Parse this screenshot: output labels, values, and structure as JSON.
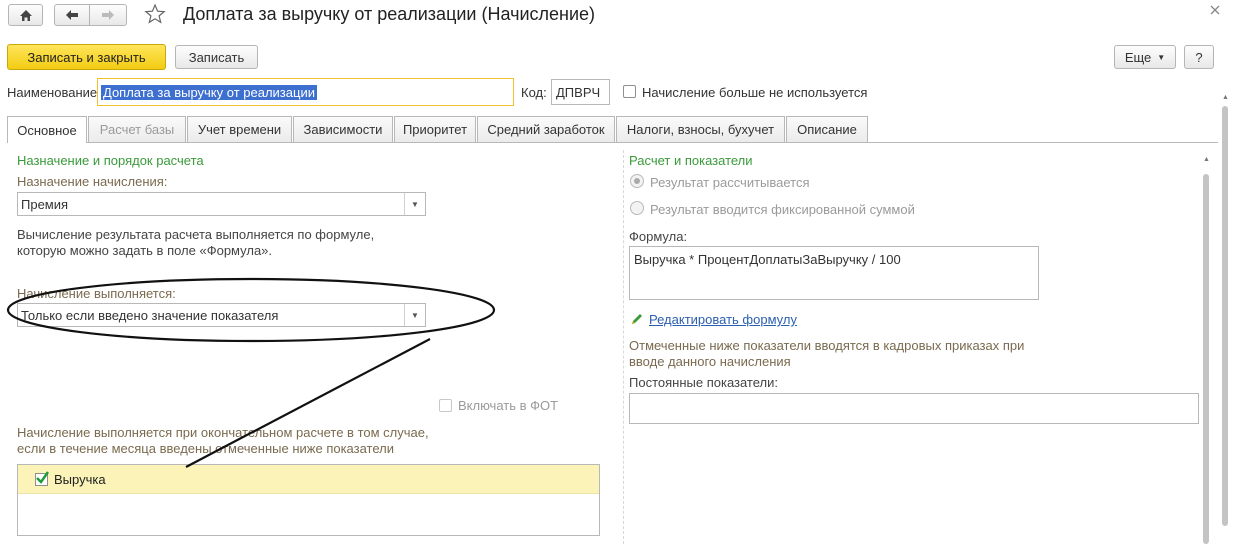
{
  "window": {
    "title": "Доплата за выручку от реализации (Начисление)",
    "home_icon": "home-icon",
    "back_icon": "arrow-left-icon",
    "forward_icon": "arrow-right-icon",
    "star_icon": "star-icon",
    "close_icon": "close-icon"
  },
  "toolbar": {
    "save_close_label": "Записать и закрыть",
    "save_label": "Записать",
    "more_label": "Еще",
    "help_label": "?"
  },
  "form": {
    "name_label": "Наименование:",
    "name_value": "Доплата за выручку от реализации",
    "code_label": "Код:",
    "code_value": "ДПВРЧ",
    "not_used_label": "Начисление больше не используется"
  },
  "tabs": [
    {
      "label": "Основное"
    },
    {
      "label": "Расчет базы"
    },
    {
      "label": "Учет времени"
    },
    {
      "label": "Зависимости"
    },
    {
      "label": "Приоритет"
    },
    {
      "label": "Средний заработок"
    },
    {
      "label": "Налоги, взносы, бухучет"
    },
    {
      "label": "Описание"
    }
  ],
  "left": {
    "section_title": "Назначение и порядок расчета",
    "purpose_label": "Назначение начисления:",
    "purpose_value": "Премия",
    "calc_note_1": "Вычисление результата расчета выполняется по формуле,",
    "calc_note_2": "которую можно задать в поле «Формула».",
    "performed_label": "Начисление выполняется:",
    "performed_value": "Только если введено значение показателя",
    "fot_label": "Включать в ФОТ",
    "info_1": "Начисление выполняется при окончательном расчете в том случае,",
    "info_2": "если в течение месяца введены отмеченные ниже показатели",
    "indicators": [
      {
        "label": "Выручка",
        "checked": true
      }
    ]
  },
  "right": {
    "section_title": "Расчет и показатели",
    "radio_calculated": "Результат рассчитывается",
    "radio_fixed": "Результат вводится фиксированной суммой",
    "formula_label": "Формула:",
    "formula_value": "Выручка * ПроцентДоплатыЗаВыручку / 100",
    "edit_formula_link": "Редактировать формулу",
    "edit_icon": "pencil-icon",
    "hr_note_1": "Отмеченные ниже показатели вводятся в кадровых приказах при",
    "hr_note_2": "вводе данного начисления",
    "const_label": "Постоянные показатели:"
  },
  "colors": {
    "accent_button": "#f5d323",
    "section_title": "#3a9a3a",
    "link": "#2b5fb0",
    "selected_row": "#fbf3b8",
    "selection_text": "#3d6fd0"
  }
}
